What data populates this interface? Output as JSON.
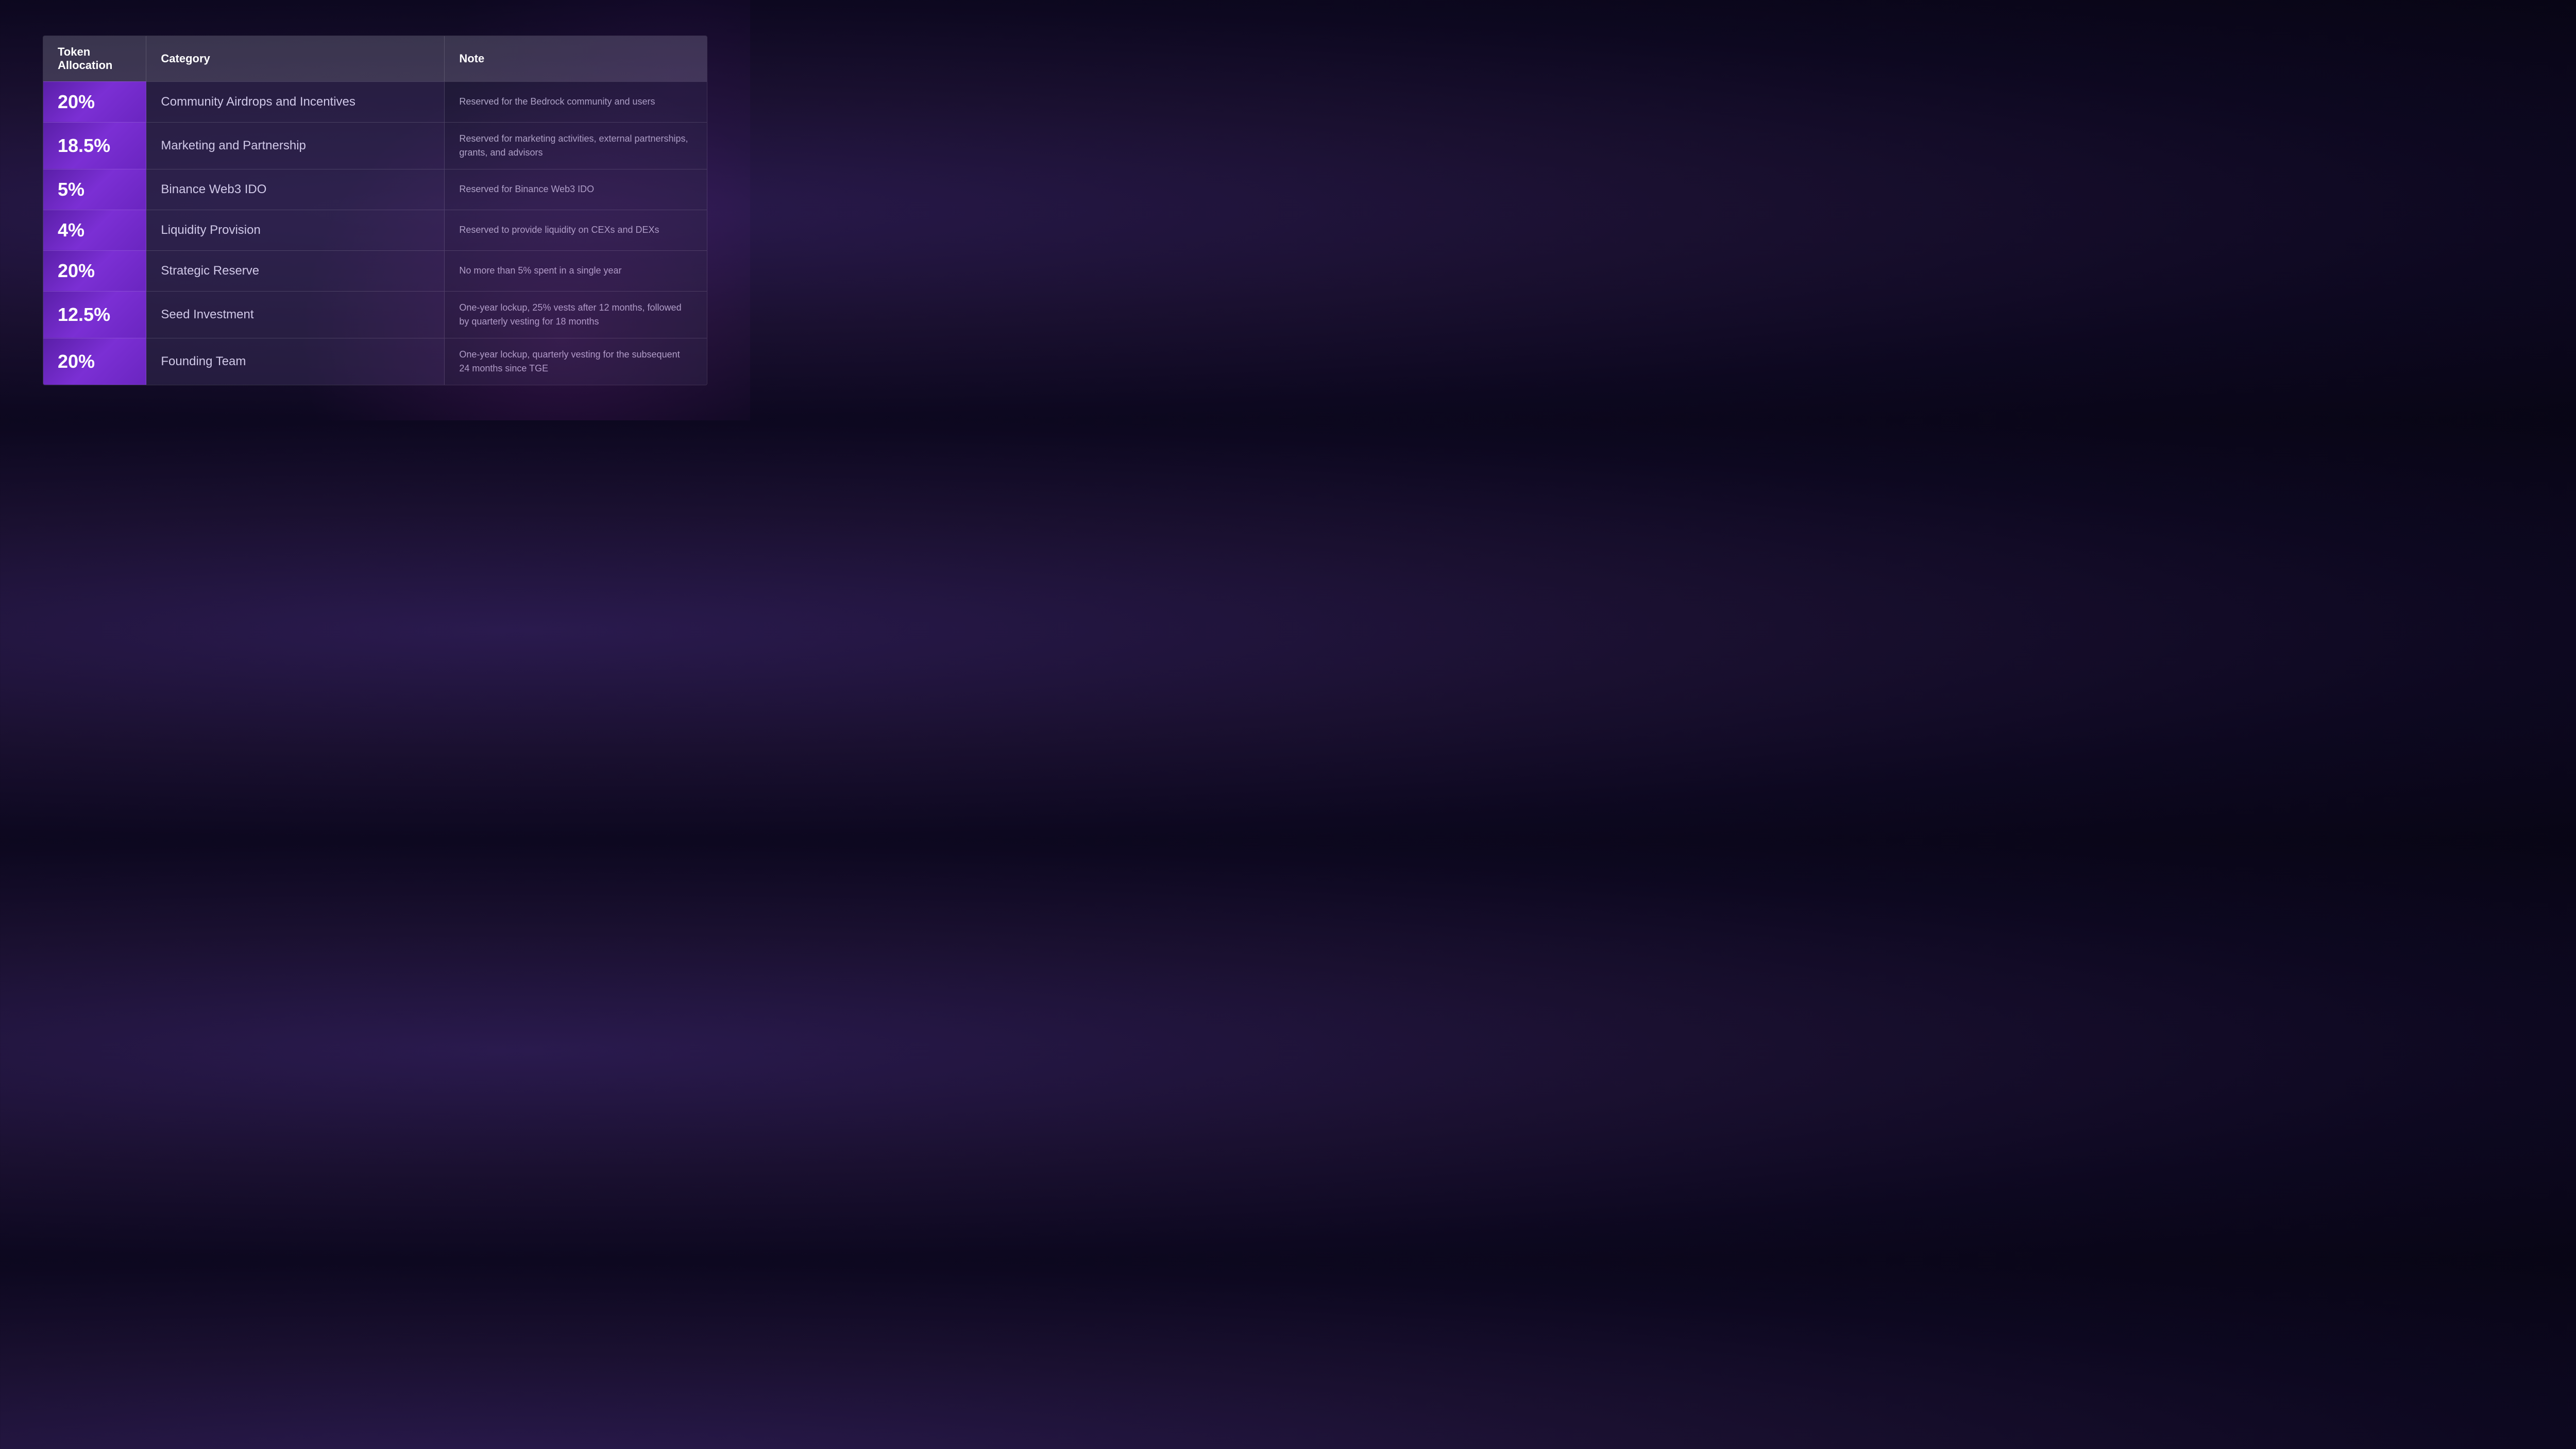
{
  "table": {
    "headers": {
      "allocation": "Token\nAllocation",
      "allocation_line1": "Token",
      "allocation_line2": "Allocation",
      "category": "Category",
      "note": "Note"
    },
    "rows": [
      {
        "pct": "20%",
        "category": "Community Airdrops and Incentives",
        "note": "Reserved for the Bedrock community and users"
      },
      {
        "pct": "18.5%",
        "category": "Marketing and Partnership",
        "note": "Reserved for marketing activities, external partnerships, grants, and advisors"
      },
      {
        "pct": "5%",
        "category": "Binance Web3 IDO",
        "note": "Reserved for Binance Web3 IDO"
      },
      {
        "pct": "4%",
        "category": "Liquidity Provision",
        "note": "Reserved to provide liquidity on CEXs and DEXs"
      },
      {
        "pct": "20%",
        "category": "Strategic Reserve",
        "note": "No more than 5% spent in a single year"
      },
      {
        "pct": "12.5%",
        "category": "Seed Investment",
        "note": "One-year lockup, 25% vests after 12 months, followed by quarterly vesting for 18 months"
      },
      {
        "pct": "20%",
        "category": "Founding Team",
        "note": "One-year lockup, quarterly vesting for the subsequent 24 months since TGE"
      }
    ]
  }
}
